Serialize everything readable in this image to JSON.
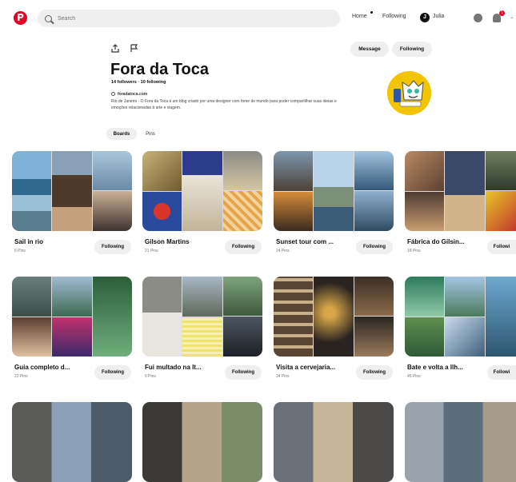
{
  "header": {
    "logo": "P",
    "search_placeholder": "Search",
    "nav_home": "Home",
    "nav_following": "Following",
    "user_initial": "J",
    "user_name": "Julia",
    "notif_count": "1",
    "chevron": "⌄"
  },
  "profile": {
    "message_label": "Message",
    "following_label": "Following",
    "title": "Fora da Toca",
    "stats": "14 followers · 10 following",
    "website": "foradatoca.com",
    "bio": "Rio de Janeiro · O Fora da Toca é um blog criado por uma designer com fome de mundo para poder compartilhar suas ideias e emoções relacionadas à arte e viagem.",
    "tabs": [
      "Boards",
      "Pins"
    ],
    "avatar_color": "#f2c500"
  },
  "boards": [
    {
      "name": "Sail in rio",
      "count": "6 Pins",
      "button": "Following"
    },
    {
      "name": "Gilson Martins",
      "count": "21 Pins",
      "button": "Following"
    },
    {
      "name": "Sunset tour com ...",
      "count": "24 Pins",
      "button": "Following"
    },
    {
      "name": "Fábrica do Gilsin...",
      "count": "18 Pins",
      "button": "Followi"
    },
    {
      "name": "Guia completo d...",
      "count": "22 Pins",
      "button": "Following"
    },
    {
      "name": "Fui multado na It...",
      "count": "6 Pins",
      "button": "Following"
    },
    {
      "name": "Visita a cervejaria...",
      "count": "34 Pins",
      "button": "Following"
    },
    {
      "name": "Bate e volta a Ilh...",
      "count": "45 Pins",
      "button": "Followi"
    }
  ],
  "colors": {
    "brand": "#e60023",
    "button_bg": "#efefef"
  }
}
